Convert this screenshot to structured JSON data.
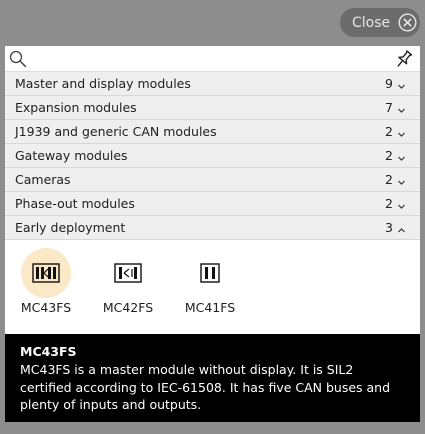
{
  "close_button": {
    "label": "Close",
    "icon": "close-circle-icon"
  },
  "search": {
    "value": "",
    "placeholder": ""
  },
  "categories": [
    {
      "label": "Master and display modules",
      "count": "9",
      "state": "collapsed"
    },
    {
      "label": "Expansion modules",
      "count": "7",
      "state": "collapsed"
    },
    {
      "label": "J1939 and generic CAN modules",
      "count": "2",
      "state": "collapsed"
    },
    {
      "label": "Gateway modules",
      "count": "2",
      "state": "collapsed"
    },
    {
      "label": "Cameras",
      "count": "2",
      "state": "collapsed"
    },
    {
      "label": "Phase-out modules",
      "count": "2",
      "state": "collapsed"
    },
    {
      "label": "Early deployment",
      "count": "3",
      "state": "expanded"
    }
  ],
  "modules": [
    {
      "name": "MC43FS",
      "selected": true
    },
    {
      "name": "MC42FS",
      "selected": false
    },
    {
      "name": "MC41FS",
      "selected": false
    }
  ],
  "description": {
    "title": "MC43FS",
    "text": "MC43FS is a master module without display. It is SIL2 certified according to IEC-61508. It has five CAN buses and plenty of inputs and outputs."
  },
  "colors": {
    "background": "#8d8d8d",
    "close_button": "#6c6c6c",
    "category_row": "#efefef",
    "selected_highlight": "#fbe8c6",
    "description_bg": "#000000"
  }
}
